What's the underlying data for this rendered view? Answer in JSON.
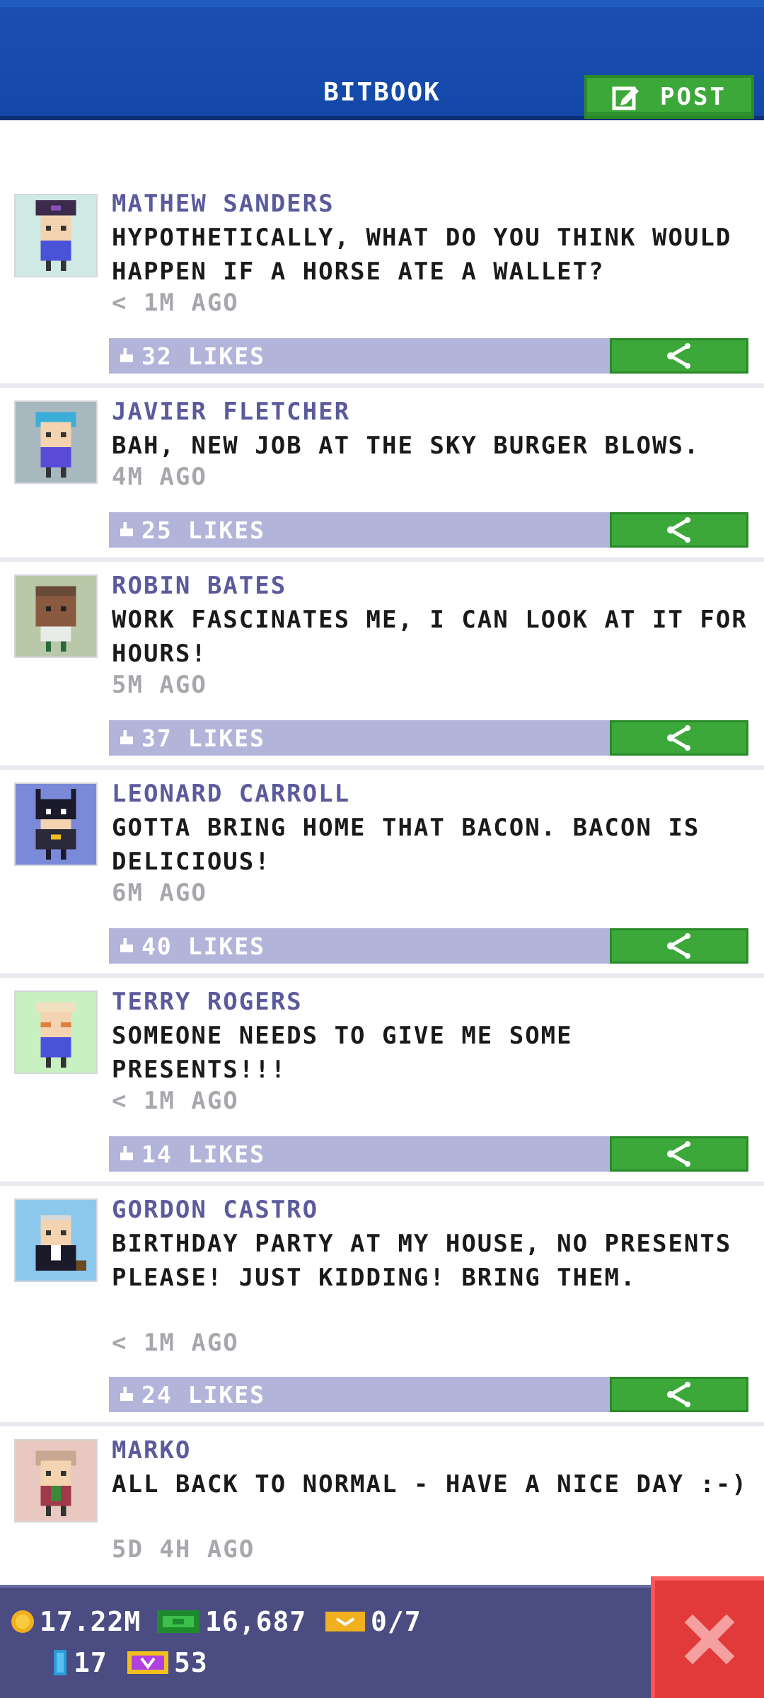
{
  "header": {
    "title": "BITBOOK",
    "post_label": "POST"
  },
  "posts": [
    {
      "name": "MATHEW SANDERS",
      "message": "HYPOTHETICALLY, WHAT DO YOU THINK WOULD HAPPEN IF A HORSE ATE A WALLET?",
      "time": "< 1M AGO",
      "likes": "32 LIKES"
    },
    {
      "name": "JAVIER FLETCHER",
      "message": "BAH, NEW JOB AT THE SKY BURGER BLOWS.",
      "time": "4M AGO",
      "likes": "25 LIKES"
    },
    {
      "name": "ROBIN BATES",
      "message": "WORK FASCINATES ME, I CAN LOOK AT IT FOR HOURS!",
      "time": "5M AGO",
      "likes": "37 LIKES"
    },
    {
      "name": "LEONARD CARROLL",
      "message": "GOTTA BRING HOME THAT BACON. BACON IS DELICIOUS!",
      "time": "6M AGO",
      "likes": "40 LIKES"
    },
    {
      "name": "TERRY ROGERS",
      "message": "SOMEONE NEEDS TO GIVE ME SOME PRESENTS!!!",
      "time": "< 1M AGO",
      "likes": "14 LIKES"
    },
    {
      "name": "GORDON CASTRO",
      "message": "BIRTHDAY PARTY AT MY HOUSE, NO PRESENTS PLEASE! JUST KIDDING! BRING THEM.",
      "time": "< 1M AGO",
      "likes": "24 LIKES"
    },
    {
      "name": "MARKO",
      "message": "ALL BACK TO NORMAL - HAVE A NICE DAY :-)",
      "time": "5D 4H AGO",
      "likes": ""
    }
  ],
  "status_bar": {
    "coins": "17.22M",
    "bux": "16,687",
    "tickets": "0/7",
    "keys": "17",
    "vip": "53"
  },
  "colors": {
    "header_bg": "#1448a8",
    "accent_green": "#3da83a",
    "name_purple": "#5b5a9c",
    "like_bar": "#b3b4d9",
    "close_red": "#e23a3a"
  },
  "icons": {
    "post": "edit-icon",
    "share": "share-icon",
    "like": "thumbs-up-icon",
    "close": "close-icon",
    "coins": "coin-icon",
    "bux": "cash-icon",
    "tickets": "ticket-icon",
    "keys": "key-icon",
    "vip": "vip-icon"
  }
}
